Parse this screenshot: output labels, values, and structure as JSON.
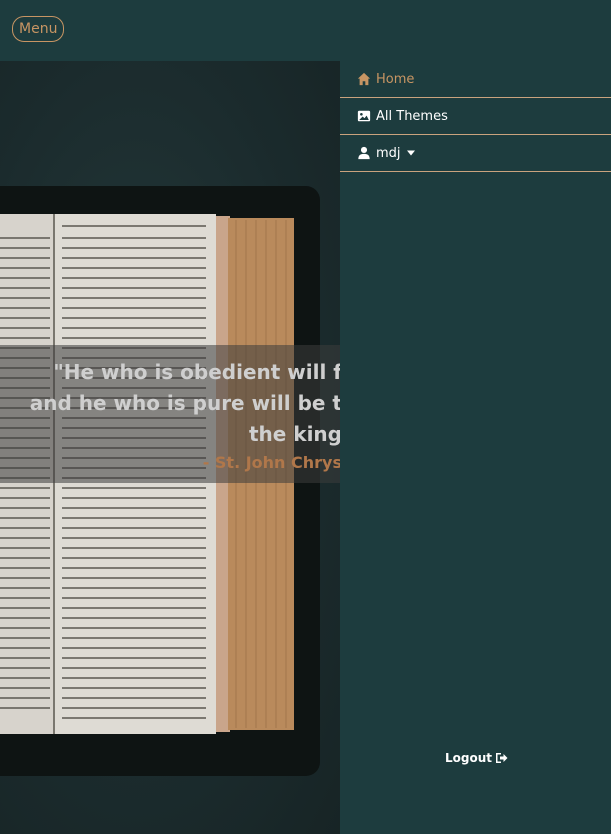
{
  "header": {
    "menu_label": "Menu"
  },
  "hero": {
    "image_icon": "open-bible-image",
    "quote_lines": [
      "\"He who is obedient will f",
      "and he who is pure will be t",
      "the king"
    ],
    "quote_author": "- St. John Chrys"
  },
  "nav": {
    "items": [
      {
        "label": "Home",
        "icon": "home-icon"
      },
      {
        "label": "All Themes",
        "icon": "image-icon"
      },
      {
        "label": "mdj",
        "icon": "user-icon"
      }
    ],
    "logout_label": "Logout"
  },
  "colors": {
    "background": "#1d3c3e",
    "accent": "#c79563",
    "divider": "#c9a37e"
  }
}
